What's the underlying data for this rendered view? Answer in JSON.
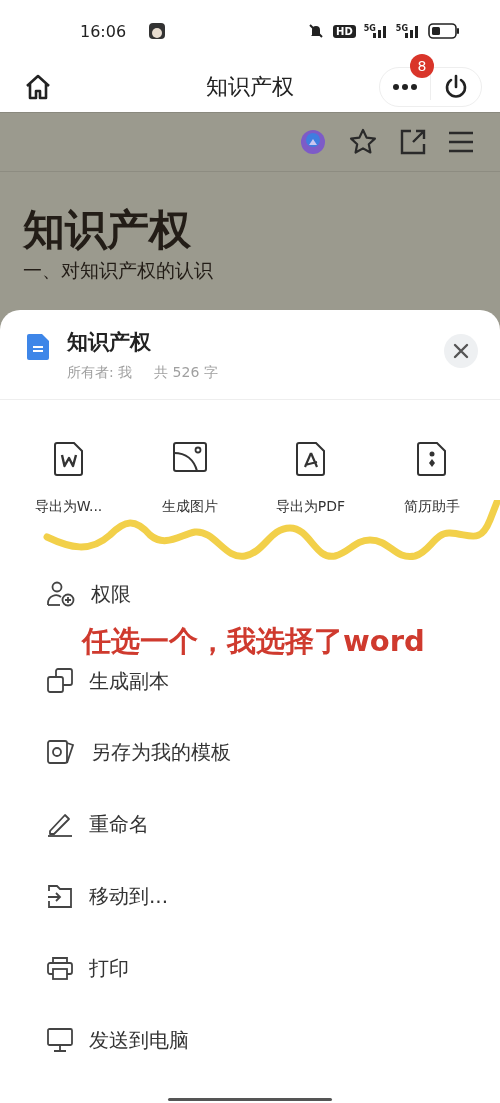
{
  "status_bar": {
    "time": "16:06",
    "hd_label": "HD",
    "signals": [
      {
        "label": "5G"
      },
      {
        "label": "5G"
      }
    ]
  },
  "header": {
    "title": "知识产权",
    "badge": "8"
  },
  "document": {
    "heading": "知识产权",
    "line": "一、对知识产权的认识"
  },
  "sheet": {
    "title": "知识产权",
    "owner": "所有者: 我",
    "count": "共 526 字",
    "actions": [
      {
        "label": "导出为W..."
      },
      {
        "label": "生成图片"
      },
      {
        "label": "导出为PDF"
      },
      {
        "label": "简历助手"
      }
    ],
    "items": [
      {
        "label": "权限"
      },
      {
        "label": "生成副本"
      },
      {
        "label": "另存为我的模板"
      },
      {
        "label": "重命名"
      },
      {
        "label": "移动到..."
      },
      {
        "label": "打印"
      },
      {
        "label": "发送到电脑"
      }
    ]
  },
  "annotation": {
    "text": "任选一个，我选择了word"
  }
}
